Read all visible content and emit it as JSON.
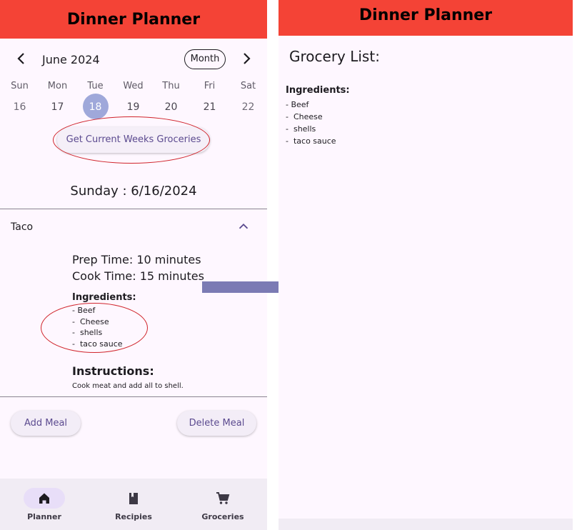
{
  "app_title": "Dinner Planner",
  "calendar": {
    "month_label": "June 2024",
    "format_button": "Month",
    "weekdays": [
      "Sun",
      "Mon",
      "Tue",
      "Wed",
      "Thu",
      "Fri",
      "Sat"
    ],
    "days": [
      "16",
      "17",
      "18",
      "19",
      "20",
      "21",
      "22"
    ],
    "selected_day": "18"
  },
  "groceries_button": "Get Current Weeks Groceries",
  "selected_date": "Sunday : 6/16/2024",
  "meal": {
    "name": "Taco",
    "prep_time": "Prep Time: 10 minutes",
    "cook_time": "Cook Time: 15 minutes",
    "ingredients_title": "Ingredients:",
    "ingredients": [
      "- Beef",
      "-  Cheese",
      "-  shells",
      "-  taco sauce"
    ],
    "instructions_title": "Instructions:",
    "instructions": "Cook meat and add all to shell."
  },
  "actions": {
    "add_meal": "Add Meal",
    "delete_meal": "Delete Meal"
  },
  "nav": {
    "items": [
      {
        "label": "Planner",
        "icon": "home-icon",
        "active": true
      },
      {
        "label": "Recipies",
        "icon": "book-icon",
        "active": false
      },
      {
        "label": "Groceries",
        "icon": "cart-icon",
        "active": false
      }
    ]
  },
  "grocery": {
    "title": "Grocery List:",
    "ingredients_title": "Ingredients:",
    "ingredients": [
      "- Beef",
      "-  Cheese",
      "-  shells",
      "-  taco sauce"
    ]
  },
  "colors": {
    "appbar": "#f44336",
    "background": "#fef7ff",
    "selected_day": "#9fa8da",
    "annotation_circle": "#d0242b",
    "arrow": "#7b7bb4"
  }
}
